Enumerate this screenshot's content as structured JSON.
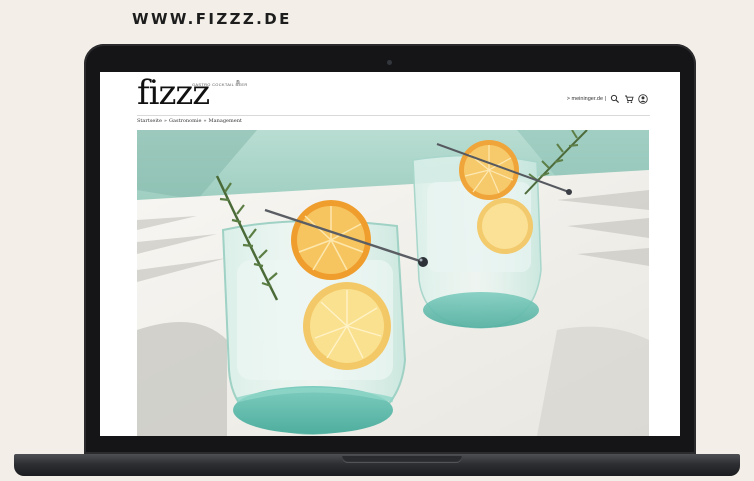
{
  "site_label": "WWW.FIZZZ.DE",
  "site": {
    "logo": "fizzz",
    "logo_mark": "®",
    "logo_tagline": "GASTRO COCKTAIL BEER",
    "nav_link": "> meininger.de |",
    "icons": [
      "search-icon",
      "cart-icon",
      "user-icon"
    ],
    "breadcrumb": [
      "Startseite",
      "»",
      "Gastronomie",
      "»",
      "Management"
    ]
  },
  "colors": {
    "background": "#f3efe8",
    "laptop_frame": "#151517",
    "hero_wall": "#a6d3c6"
  }
}
